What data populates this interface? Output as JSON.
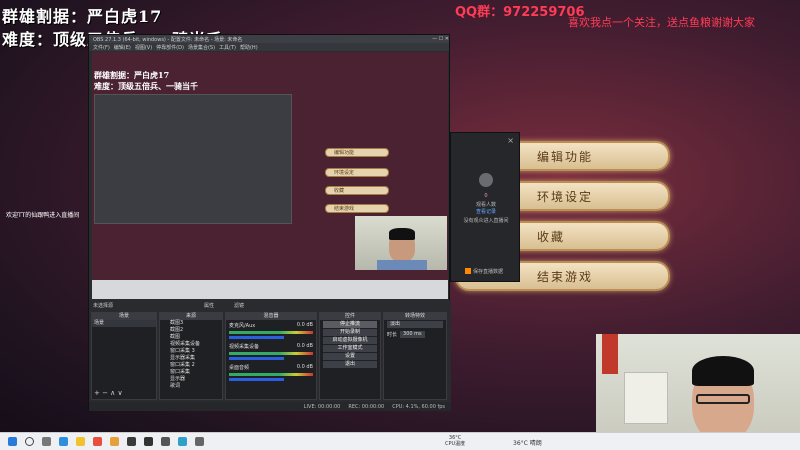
{
  "overlay": {
    "title": "群雄割据：严白虎17",
    "difficulty": "难度：顶级五倍兵、一骑当千",
    "qq": "QQ群：972259706",
    "scroll": "喜欢我点一个关注，送点鱼粮谢谢大家",
    "welcome": "欢迎TT的仙跟鸭进入直播间"
  },
  "game_menu": {
    "items": [
      "编辑功能",
      "环境设定",
      "收藏",
      "结束游戏"
    ]
  },
  "popup": {
    "close": "×",
    "count": "0",
    "line1": "观看人数",
    "line2": "查看记录",
    "line3": "没有观众进入直播间",
    "footer": "保存直播数据"
  },
  "obs": {
    "title": "OBS 27.1.3 (64-bit, windows) - 配置文件: 未命名 - 场景: 未命名",
    "menu": [
      "文件(F)",
      "编辑(E)",
      "视图(V)",
      "停靠部件(D)",
      "场景集合(S)",
      "工具(T)",
      "帮助(H)"
    ],
    "preview_title": "群雄割据：严白虎17",
    "preview_diff": "难度：顶级五倍兵、一骑当千",
    "preview_menu": [
      "编辑功能",
      "环境设定",
      "收藏",
      "结束游戏"
    ],
    "no_source": "未选择源",
    "props": "属性",
    "filters": "滤镜",
    "docks": {
      "scenes": "场景",
      "sources": "来源",
      "mixer": "混音器",
      "controls": "控件",
      "transitions": "转场特效"
    },
    "scenes": [
      "场景"
    ],
    "sources": [
      "截图3",
      "截图2",
      "截图",
      "视频采集设备",
      "窗口采集 3",
      "显示器采集",
      "窗口采集 2",
      "窗口采集",
      "显示器",
      "歌词",
      "媒体源"
    ],
    "mixer": [
      {
        "name": "麦克风/Aux",
        "db": "0.0 dB"
      },
      {
        "name": "视频采集设备",
        "db": "0.0 dB"
      },
      {
        "name": "桌面音频",
        "db": "0.0 dB"
      }
    ],
    "controls": [
      "停止推流",
      "开始录制",
      "启动虚拟摄像机",
      "工作室模式",
      "设置",
      "退出"
    ],
    "transition": {
      "type": "淡出",
      "duration_label": "时长",
      "duration": "300 ms"
    },
    "status": {
      "live": "LIVE: 00:00:00",
      "rec": "REC: 00:00:00",
      "cpu": "CPU: 4.1%, 60.00 fps"
    }
  },
  "taskbar": {
    "weather_temp": "36°C",
    "weather_label": "CPU温度",
    "temp": "36°C 晴朗"
  }
}
